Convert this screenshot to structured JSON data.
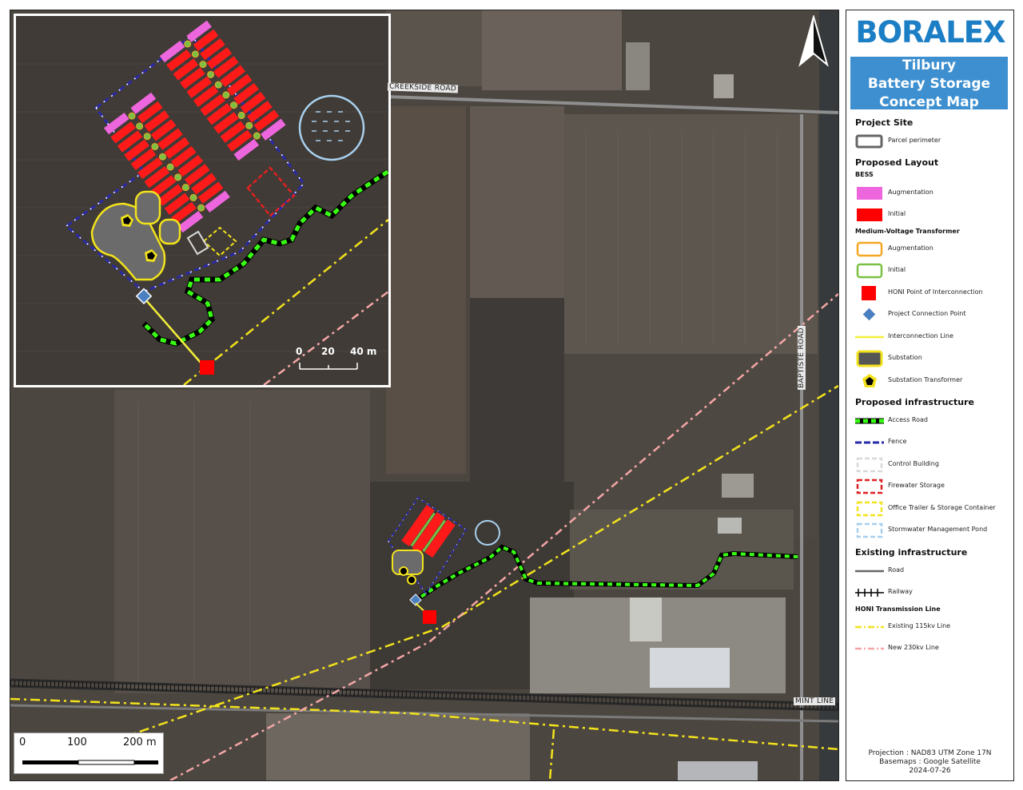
{
  "brand": {
    "logo_text": "BORALEX",
    "color": "#1c7ec4"
  },
  "title": {
    "line1": "Tilbury",
    "line2": "Battery Storage",
    "line3": "Concept Map",
    "bg": "#3d8fd0"
  },
  "map": {
    "road_labels": {
      "creekside": "CREEKSIDE ROAD",
      "baptiste": "BAPTISTE ROAD",
      "mint": "MINT LINE"
    },
    "scale_main": {
      "t0": "0",
      "t1": "100",
      "t2": "200 m"
    },
    "scale_inset": {
      "t0": "0",
      "t1": "20",
      "t2": "40 m"
    },
    "north_icon": "north-arrow-icon"
  },
  "legend": {
    "project_site": {
      "title": "Project Site",
      "items": [
        {
          "label": "Parcel perimeter"
        }
      ]
    },
    "proposed_layout": {
      "title": "Proposed Layout",
      "bess_title": "BESS",
      "bess": [
        {
          "label": "Augmentation",
          "color": "#ee66dd"
        },
        {
          "label": "Initial",
          "color": "#ff0000"
        }
      ],
      "mvt_title": "Medium-Voltage Transformer",
      "mvt": [
        {
          "label": "Augmentation",
          "color": "#f5a623"
        },
        {
          "label": "Initial",
          "color": "#7ac143"
        }
      ],
      "other": [
        {
          "label": "HONI Point of Interconnection",
          "color": "#ff0000"
        },
        {
          "label": "Project Connection Point",
          "color": "#4a7fc1"
        },
        {
          "label": "Interconnection Line",
          "color": "#f2ef3a"
        },
        {
          "label": "Substation",
          "color": "#f2e21c"
        },
        {
          "label": "Substation Transformer",
          "color": "#f2e21c"
        }
      ]
    },
    "proposed_infrastructure": {
      "title": "Proposed infrastructure",
      "items": [
        {
          "label": "Access Road",
          "color": "#39ff14"
        },
        {
          "label": "Fence",
          "color": "#2a2aa8"
        },
        {
          "label": "Control Building",
          "color": "#d9d9d9"
        },
        {
          "label": "Firewater Storage",
          "color": "#e02020"
        },
        {
          "label": "Office Trailer & Storage Container",
          "color": "#f2e21c"
        },
        {
          "label": "Stormwater Management Pond",
          "color": "#a8d0ee"
        }
      ]
    },
    "existing_infrastructure": {
      "title": "Existing infrastructure",
      "items": [
        {
          "label": "Road"
        },
        {
          "label": "Railway"
        }
      ],
      "honi_title": "HONI Transmission Line",
      "honi": [
        {
          "label": "Existing 115kv Line",
          "color": "#f2e21c"
        },
        {
          "label": "New 230kv Line",
          "color": "#f4a6a6"
        }
      ]
    }
  },
  "footer": {
    "projection": "Projection : NAD83 UTM Zone 17N",
    "basemaps": "Basemaps : Google Satellite",
    "date": "2024-07-26"
  }
}
